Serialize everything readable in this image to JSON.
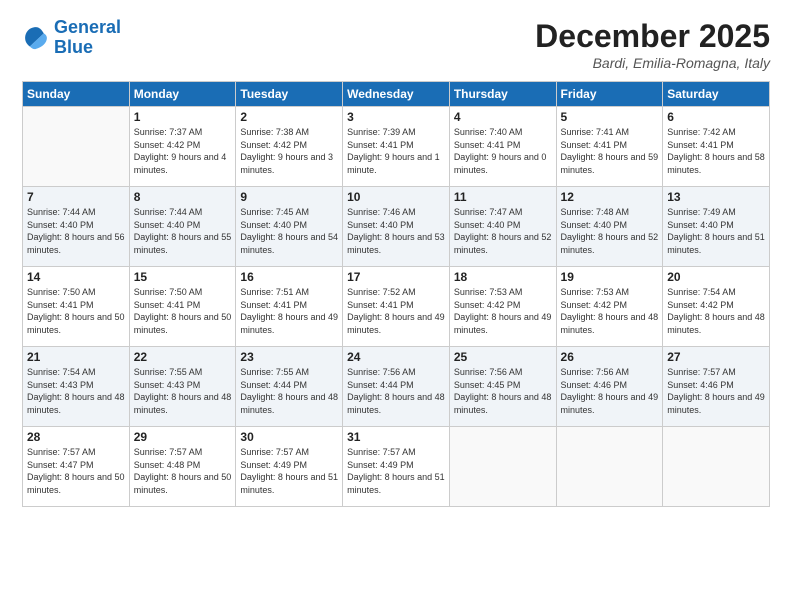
{
  "header": {
    "logo_line1": "General",
    "logo_line2": "Blue",
    "month": "December 2025",
    "location": "Bardi, Emilia-Romagna, Italy"
  },
  "days_header": [
    "Sunday",
    "Monday",
    "Tuesday",
    "Wednesday",
    "Thursday",
    "Friday",
    "Saturday"
  ],
  "weeks": [
    [
      {
        "day": "",
        "sunrise": "",
        "sunset": "",
        "daylight": ""
      },
      {
        "day": "1",
        "sunrise": "Sunrise: 7:37 AM",
        "sunset": "Sunset: 4:42 PM",
        "daylight": "Daylight: 9 hours and 4 minutes."
      },
      {
        "day": "2",
        "sunrise": "Sunrise: 7:38 AM",
        "sunset": "Sunset: 4:42 PM",
        "daylight": "Daylight: 9 hours and 3 minutes."
      },
      {
        "day": "3",
        "sunrise": "Sunrise: 7:39 AM",
        "sunset": "Sunset: 4:41 PM",
        "daylight": "Daylight: 9 hours and 1 minute."
      },
      {
        "day": "4",
        "sunrise": "Sunrise: 7:40 AM",
        "sunset": "Sunset: 4:41 PM",
        "daylight": "Daylight: 9 hours and 0 minutes."
      },
      {
        "day": "5",
        "sunrise": "Sunrise: 7:41 AM",
        "sunset": "Sunset: 4:41 PM",
        "daylight": "Daylight: 8 hours and 59 minutes."
      },
      {
        "day": "6",
        "sunrise": "Sunrise: 7:42 AM",
        "sunset": "Sunset: 4:41 PM",
        "daylight": "Daylight: 8 hours and 58 minutes."
      }
    ],
    [
      {
        "day": "7",
        "sunrise": "Sunrise: 7:44 AM",
        "sunset": "Sunset: 4:40 PM",
        "daylight": "Daylight: 8 hours and 56 minutes."
      },
      {
        "day": "8",
        "sunrise": "Sunrise: 7:44 AM",
        "sunset": "Sunset: 4:40 PM",
        "daylight": "Daylight: 8 hours and 55 minutes."
      },
      {
        "day": "9",
        "sunrise": "Sunrise: 7:45 AM",
        "sunset": "Sunset: 4:40 PM",
        "daylight": "Daylight: 8 hours and 54 minutes."
      },
      {
        "day": "10",
        "sunrise": "Sunrise: 7:46 AM",
        "sunset": "Sunset: 4:40 PM",
        "daylight": "Daylight: 8 hours and 53 minutes."
      },
      {
        "day": "11",
        "sunrise": "Sunrise: 7:47 AM",
        "sunset": "Sunset: 4:40 PM",
        "daylight": "Daylight: 8 hours and 52 minutes."
      },
      {
        "day": "12",
        "sunrise": "Sunrise: 7:48 AM",
        "sunset": "Sunset: 4:40 PM",
        "daylight": "Daylight: 8 hours and 52 minutes."
      },
      {
        "day": "13",
        "sunrise": "Sunrise: 7:49 AM",
        "sunset": "Sunset: 4:40 PM",
        "daylight": "Daylight: 8 hours and 51 minutes."
      }
    ],
    [
      {
        "day": "14",
        "sunrise": "Sunrise: 7:50 AM",
        "sunset": "Sunset: 4:41 PM",
        "daylight": "Daylight: 8 hours and 50 minutes."
      },
      {
        "day": "15",
        "sunrise": "Sunrise: 7:50 AM",
        "sunset": "Sunset: 4:41 PM",
        "daylight": "Daylight: 8 hours and 50 minutes."
      },
      {
        "day": "16",
        "sunrise": "Sunrise: 7:51 AM",
        "sunset": "Sunset: 4:41 PM",
        "daylight": "Daylight: 8 hours and 49 minutes."
      },
      {
        "day": "17",
        "sunrise": "Sunrise: 7:52 AM",
        "sunset": "Sunset: 4:41 PM",
        "daylight": "Daylight: 8 hours and 49 minutes."
      },
      {
        "day": "18",
        "sunrise": "Sunrise: 7:53 AM",
        "sunset": "Sunset: 4:42 PM",
        "daylight": "Daylight: 8 hours and 49 minutes."
      },
      {
        "day": "19",
        "sunrise": "Sunrise: 7:53 AM",
        "sunset": "Sunset: 4:42 PM",
        "daylight": "Daylight: 8 hours and 48 minutes."
      },
      {
        "day": "20",
        "sunrise": "Sunrise: 7:54 AM",
        "sunset": "Sunset: 4:42 PM",
        "daylight": "Daylight: 8 hours and 48 minutes."
      }
    ],
    [
      {
        "day": "21",
        "sunrise": "Sunrise: 7:54 AM",
        "sunset": "Sunset: 4:43 PM",
        "daylight": "Daylight: 8 hours and 48 minutes."
      },
      {
        "day": "22",
        "sunrise": "Sunrise: 7:55 AM",
        "sunset": "Sunset: 4:43 PM",
        "daylight": "Daylight: 8 hours and 48 minutes."
      },
      {
        "day": "23",
        "sunrise": "Sunrise: 7:55 AM",
        "sunset": "Sunset: 4:44 PM",
        "daylight": "Daylight: 8 hours and 48 minutes."
      },
      {
        "day": "24",
        "sunrise": "Sunrise: 7:56 AM",
        "sunset": "Sunset: 4:44 PM",
        "daylight": "Daylight: 8 hours and 48 minutes."
      },
      {
        "day": "25",
        "sunrise": "Sunrise: 7:56 AM",
        "sunset": "Sunset: 4:45 PM",
        "daylight": "Daylight: 8 hours and 48 minutes."
      },
      {
        "day": "26",
        "sunrise": "Sunrise: 7:56 AM",
        "sunset": "Sunset: 4:46 PM",
        "daylight": "Daylight: 8 hours and 49 minutes."
      },
      {
        "day": "27",
        "sunrise": "Sunrise: 7:57 AM",
        "sunset": "Sunset: 4:46 PM",
        "daylight": "Daylight: 8 hours and 49 minutes."
      }
    ],
    [
      {
        "day": "28",
        "sunrise": "Sunrise: 7:57 AM",
        "sunset": "Sunset: 4:47 PM",
        "daylight": "Daylight: 8 hours and 50 minutes."
      },
      {
        "day": "29",
        "sunrise": "Sunrise: 7:57 AM",
        "sunset": "Sunset: 4:48 PM",
        "daylight": "Daylight: 8 hours and 50 minutes."
      },
      {
        "day": "30",
        "sunrise": "Sunrise: 7:57 AM",
        "sunset": "Sunset: 4:49 PM",
        "daylight": "Daylight: 8 hours and 51 minutes."
      },
      {
        "day": "31",
        "sunrise": "Sunrise: 7:57 AM",
        "sunset": "Sunset: 4:49 PM",
        "daylight": "Daylight: 8 hours and 51 minutes."
      },
      {
        "day": "",
        "sunrise": "",
        "sunset": "",
        "daylight": ""
      },
      {
        "day": "",
        "sunrise": "",
        "sunset": "",
        "daylight": ""
      },
      {
        "day": "",
        "sunrise": "",
        "sunset": "",
        "daylight": ""
      }
    ]
  ]
}
